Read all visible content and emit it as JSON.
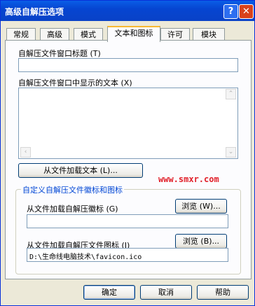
{
  "window": {
    "title": "高级自解压选项"
  },
  "titlebar": {
    "help_icon": "?",
    "close_icon": "✕"
  },
  "tabs": [
    {
      "label": "常规"
    },
    {
      "label": "高级"
    },
    {
      "label": "模式"
    },
    {
      "label": "文本和图标"
    },
    {
      "label": "许可"
    },
    {
      "label": "模块"
    }
  ],
  "text_panel": {
    "title_label": "自解压文件窗口标题 (T)",
    "title_value": "",
    "text_label": "自解压文件窗口中显示的文本 (X)",
    "text_value": "",
    "load_text_button": "从文件加载文本 (L)...",
    "watermark": "www.smxr.com"
  },
  "icon_group": {
    "title": "自定义自解压文件徽标和图标",
    "logo_label": "从文件加载自解压徽标 (G)",
    "logo_value": "",
    "logo_browse": "浏览 (W)...",
    "icon_label": "从文件加载自解压文件图标 (I)",
    "icon_value": "D:\\生命线电脑技术\\favicon.ico",
    "icon_browse": "浏览 (B)..."
  },
  "footer": {
    "ok": "确定",
    "cancel": "取消",
    "help": "帮助"
  }
}
